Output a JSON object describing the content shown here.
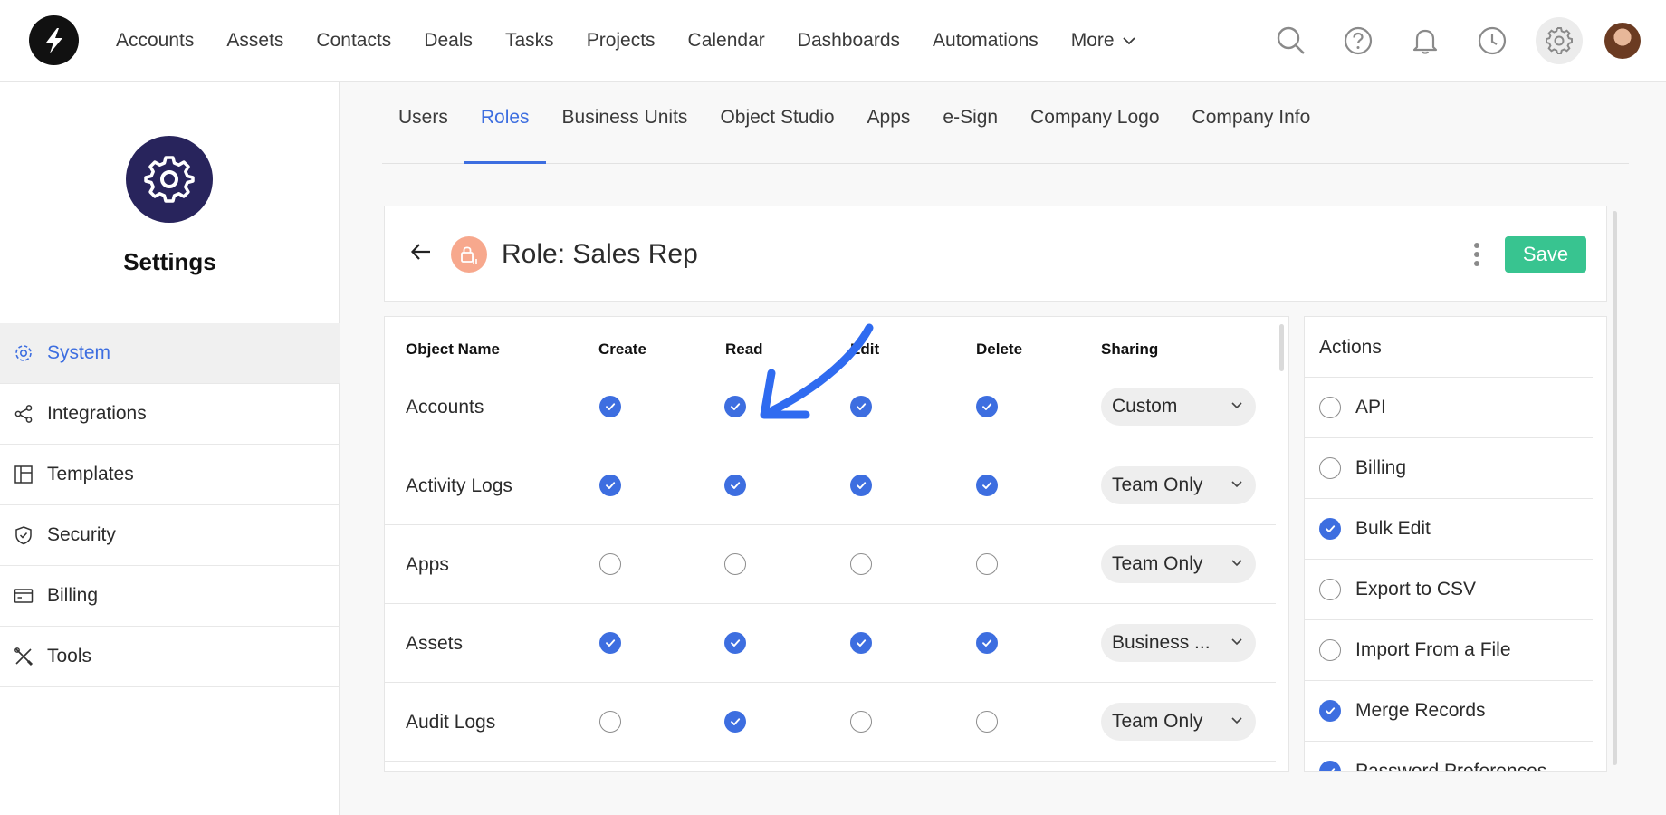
{
  "nav": {
    "items": [
      "Accounts",
      "Assets",
      "Contacts",
      "Deals",
      "Tasks",
      "Projects",
      "Calendar",
      "Dashboards",
      "Automations"
    ],
    "more_label": "More"
  },
  "top_icons": [
    "search-icon",
    "help-icon",
    "bell-icon",
    "clock-icon",
    "gear-icon"
  ],
  "sidebar": {
    "title": "Settings",
    "items": [
      {
        "label": "System",
        "icon": "gear-icon",
        "active": true
      },
      {
        "label": "Integrations",
        "icon": "share-icon"
      },
      {
        "label": "Templates",
        "icon": "template-icon"
      },
      {
        "label": "Security",
        "icon": "shield-icon"
      },
      {
        "label": "Billing",
        "icon": "card-icon"
      },
      {
        "label": "Tools",
        "icon": "tools-icon"
      }
    ]
  },
  "tabs": [
    "Users",
    "Roles",
    "Business Units",
    "Object Studio",
    "Apps",
    "e-Sign",
    "Company Logo",
    "Company Info"
  ],
  "active_tab": "Roles",
  "role": {
    "title": "Role: Sales Rep",
    "save_label": "Save"
  },
  "table": {
    "headers": {
      "name": "Object Name",
      "create": "Create",
      "read": "Read",
      "edit": "Edit",
      "delete": "Delete",
      "sharing": "Sharing"
    },
    "rows": [
      {
        "name": "Accounts",
        "create": true,
        "read": true,
        "edit": true,
        "delete": true,
        "sharing": "Custom"
      },
      {
        "name": "Activity Logs",
        "create": true,
        "read": true,
        "edit": true,
        "delete": true,
        "sharing": "Team Only"
      },
      {
        "name": "Apps",
        "create": false,
        "read": false,
        "edit": false,
        "delete": false,
        "sharing": "Team Only"
      },
      {
        "name": "Assets",
        "create": true,
        "read": true,
        "edit": true,
        "delete": true,
        "sharing": "Business ..."
      },
      {
        "name": "Audit Logs",
        "create": false,
        "read": true,
        "edit": false,
        "delete": false,
        "sharing": "Team Only"
      }
    ]
  },
  "actions": {
    "title": "Actions",
    "items": [
      {
        "label": "API",
        "checked": false
      },
      {
        "label": "Billing",
        "checked": false
      },
      {
        "label": "Bulk Edit",
        "checked": true
      },
      {
        "label": "Export to CSV",
        "checked": false
      },
      {
        "label": "Import From a File",
        "checked": false
      },
      {
        "label": "Merge Records",
        "checked": true
      },
      {
        "label": "Password Preferences",
        "checked": true
      }
    ]
  },
  "colors": {
    "accent": "#3d6ee0",
    "save": "#38c490",
    "badge": "#28245c",
    "role_icon": "#f7a88d",
    "annotation": "#2f6bf0"
  }
}
